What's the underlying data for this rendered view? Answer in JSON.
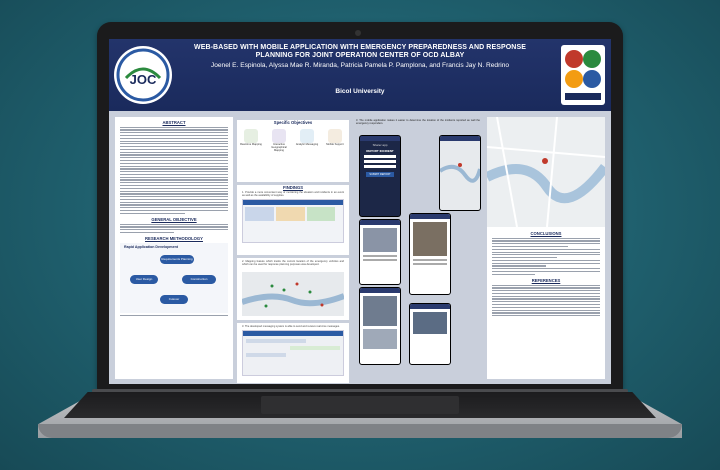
{
  "poster": {
    "title": "WEB-BASED WITH MOBILE APPLICATION WITH EMERGENCY PREPAREDNESS AND RESPONSE PLANNING FOR JOINT OPERATION CENTER OF OCD ALBAY",
    "authors": "Joenel E. Espinola, Alyssa Mae R. Miranda, Patricia Pamela P. Pamplona, and Francis Jay N. Redrino",
    "university": "Bicol University",
    "logo_text": "JOC",
    "sections": {
      "abstract": "ABSTRACT",
      "general_objective": "GENERAL OBJECTIVE",
      "research_methodology": "RESEARCH METHODOLOGY",
      "specific_objectives": "Specific Objectives",
      "findings": "FINDINGS",
      "conclusions": "CONCLUSIONS",
      "references": "REFERENCES"
    },
    "rad": {
      "title": "Rapid Application Development",
      "steps": [
        "Requirements Planning",
        "User Design",
        "Construction",
        "Cutover"
      ]
    },
    "objectives": [
      "Real-time Mapping",
      "Interactive Geographical Mapping",
      "Analytic Messaging",
      "Mobile Support"
    ],
    "findings_intro": "1. Provide a more convenient way of monitoring the situation and incidents in an event as well as the availability of supplies.",
    "finding2": "2. Mapping feature which tracks the current location of the emergency vehicles and which can be used for response planning purposes was developed.",
    "finding3": "3. The developed messaging system is able to send and receive real-time messages.",
    "col3_intro": "3. The mobile application makes it easier to determine the location of the incidents reported as well the emergency responders.",
    "phone": {
      "app_name": "Sharer app",
      "report_label": "REPORT INCIDENT",
      "submit_label": "SUBMIT REPORT"
    }
  },
  "colors": {
    "header_bg": "#1a2a5c",
    "accent": "#2b5aa3",
    "background": "#1f5f6d"
  }
}
